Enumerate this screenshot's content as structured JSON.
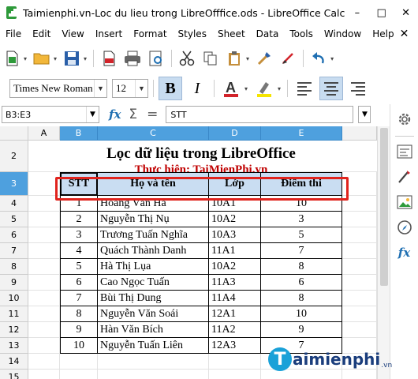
{
  "window": {
    "title": "Taimienphi.vn-Loc du lieu trong LibreOfffice.ods - LibreOffice Calc",
    "minimize": "–",
    "maximize": "□",
    "close": "✕"
  },
  "menu": [
    "File",
    "Edit",
    "View",
    "Insert",
    "Format",
    "Styles",
    "Sheet",
    "Data",
    "Tools",
    "Window",
    "Help"
  ],
  "menu_close": "✕",
  "font": {
    "name": "Times New Roman",
    "size": "12"
  },
  "formula": {
    "namebox": "B3:E3",
    "fx": "fx",
    "sigma": "Σ",
    "equals": "=",
    "content": "STT"
  },
  "columns": [
    "A",
    "B",
    "C",
    "D",
    "E"
  ],
  "rows": [
    "2",
    "3",
    "4",
    "5",
    "6",
    "7",
    "8",
    "9",
    "10",
    "11",
    "12",
    "13",
    "14",
    "15"
  ],
  "sheet": {
    "title": "Lọc dữ liệu trong LibreOffice",
    "subtitle": "Thực hiện: TaiMienPhi.vn",
    "headers": [
      "STT",
      "Họ và tên",
      "Lớp",
      "Điểm thi"
    ],
    "records": [
      [
        "1",
        "Hoàng Văn Hà",
        "10A1",
        "10"
      ],
      [
        "2",
        "Nguyễn Thị Nụ",
        "10A2",
        "3"
      ],
      [
        "3",
        "Trương Tuấn Nghĩa",
        "10A3",
        "5"
      ],
      [
        "4",
        "Quách Thành Danh",
        "11A1",
        "7"
      ],
      [
        "5",
        "Hà Thị Lụa",
        "10A2",
        "8"
      ],
      [
        "6",
        "Cao Ngọc Tuấn",
        "11A3",
        "6"
      ],
      [
        "7",
        "Bùi Thị Dung",
        "11A4",
        "8"
      ],
      [
        "8",
        "Nguyễn Văn Soái",
        "12A1",
        "10"
      ],
      [
        "9",
        "Hàn Văn Bích",
        "11A2",
        "9"
      ],
      [
        "10",
        "Nguyễn Tuấn Liên",
        "12A3",
        "7"
      ]
    ]
  },
  "watermark": {
    "letter": "T",
    "text": "aimienphi",
    "suffix": ".vn"
  },
  "colors": {
    "selection": "#4ea0de",
    "header_fill": "#c9ddf2",
    "highlight_box": "#e0231d",
    "subtitle": "#c00000"
  },
  "icons": [
    "new-icon",
    "open-icon",
    "save-icon",
    "export-pdf-icon",
    "print-icon",
    "print-preview-icon",
    "cut-icon",
    "copy-icon",
    "paste-icon",
    "clone-icon",
    "clear-icon",
    "undo-icon",
    "bold-icon",
    "italic-icon",
    "font-color-icon",
    "highlight-icon",
    "align-left-icon",
    "align-center-icon",
    "align-right-icon",
    "settings-icon",
    "properties-icon",
    "styles-icon",
    "gallery-icon",
    "navigator-icon",
    "functions-icon"
  ]
}
